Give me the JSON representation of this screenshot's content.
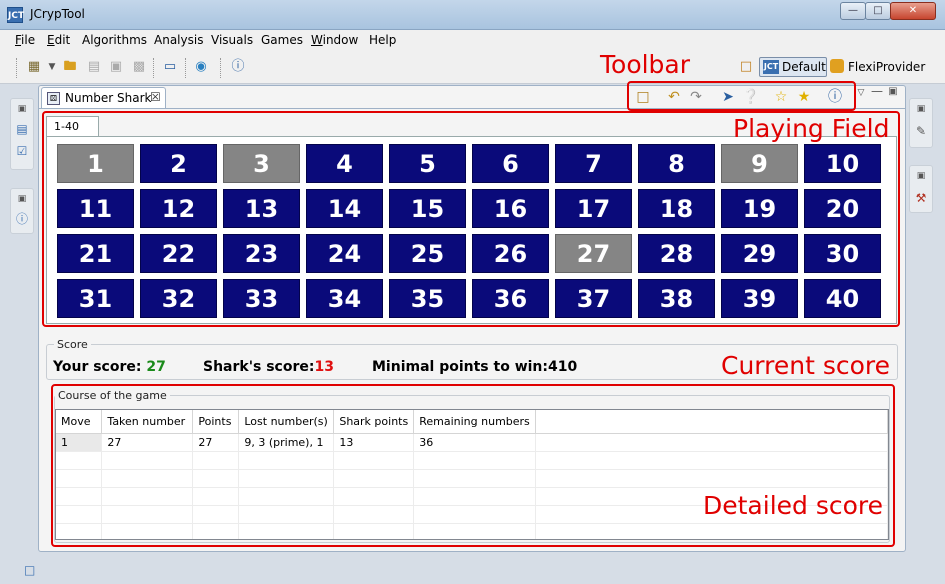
{
  "window": {
    "title": "JCrypTool",
    "app_icon": "JCT"
  },
  "menu": [
    {
      "label": "File",
      "key": "F",
      "rest": "ile"
    },
    {
      "label": "Edit",
      "key": "E",
      "rest": "dit"
    },
    {
      "label": "Algorithms",
      "key": "",
      "rest": "Algorithms"
    },
    {
      "label": "Analysis",
      "key": "",
      "rest": "Analysis"
    },
    {
      "label": "Visuals",
      "key": "",
      "rest": "Visuals"
    },
    {
      "label": "Games",
      "key": "",
      "rest": "Games"
    },
    {
      "label": "Window",
      "key": "W",
      "rest": "indow"
    },
    {
      "label": "Help",
      "key": "",
      "rest": "Help"
    }
  ],
  "perspectives": {
    "default": "Default",
    "flexi": "FlexiProvider",
    "default_icon": "JCT"
  },
  "editor": {
    "tab_title": "Number Shark",
    "tab_close": "☒",
    "tab_icon": "⚄"
  },
  "annotations": {
    "toolbar": "Toolbar",
    "playing_field": "Playing Field",
    "current_score": "Current score",
    "detailed_score": "Detailed score"
  },
  "field": {
    "tab": "1-40",
    "numbers": [
      1,
      2,
      3,
      4,
      5,
      6,
      7,
      8,
      9,
      10,
      11,
      12,
      13,
      14,
      15,
      16,
      17,
      18,
      19,
      20,
      21,
      22,
      23,
      24,
      25,
      26,
      27,
      28,
      29,
      30,
      31,
      32,
      33,
      34,
      35,
      36,
      37,
      38,
      39,
      40
    ],
    "taken": [
      1,
      3,
      9,
      27
    ],
    "colors": {
      "available": "#0a0a7a",
      "taken": "#858585"
    }
  },
  "score": {
    "caption": "Score",
    "your_label": "Your score:",
    "your_value": "27",
    "shark_label": "Shark's score:",
    "shark_value": "13",
    "min_label": "Minimal points to win:",
    "min_value": "410"
  },
  "course": {
    "caption": "Course of the game",
    "columns": [
      "Move",
      "Taken number",
      "Points",
      "Lost number(s)",
      "Shark points",
      "Remaining numbers"
    ],
    "rows": [
      [
        "1",
        "27",
        "27",
        "9, 3 (prime), 1",
        "13",
        "36"
      ]
    ],
    "empty_rows": 5
  }
}
